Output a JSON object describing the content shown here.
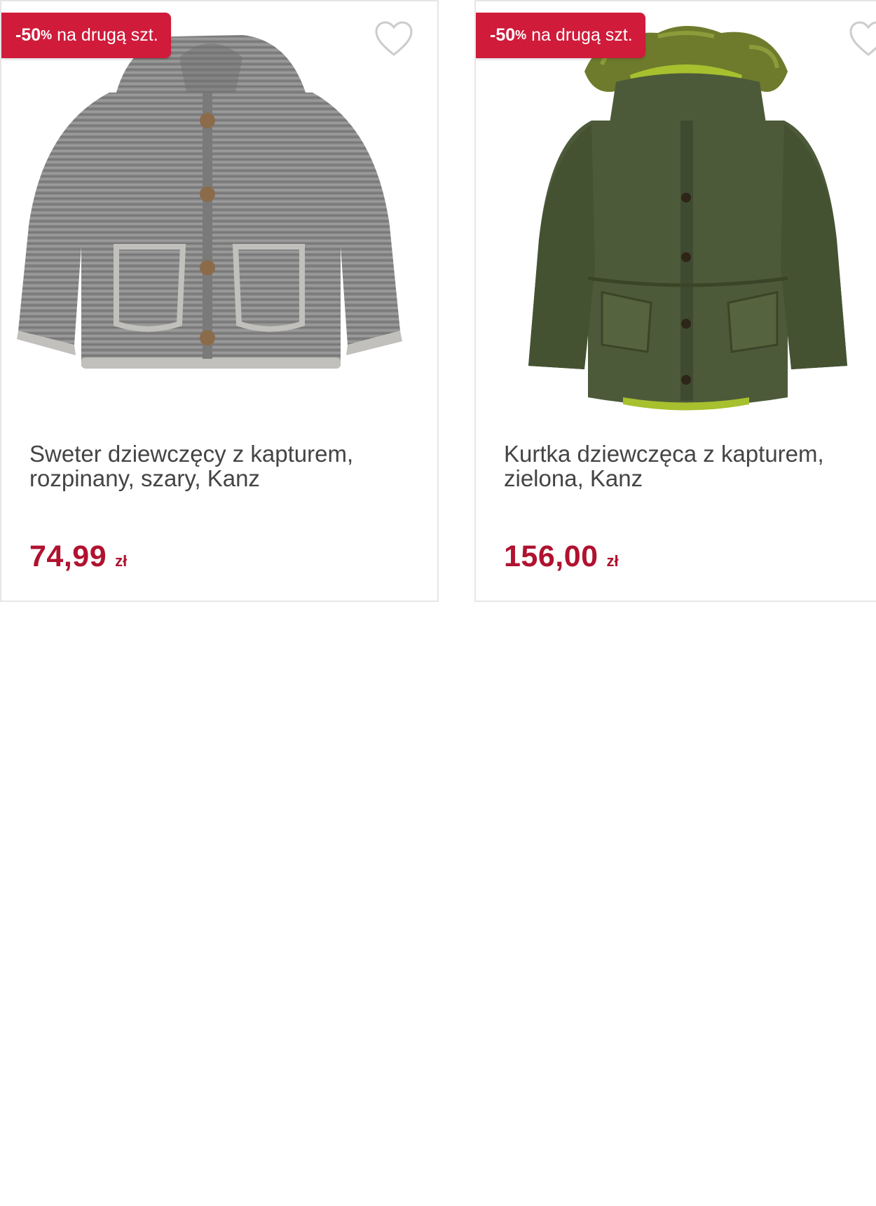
{
  "products": [
    {
      "badge_pct": "-50",
      "badge_pct_sign": "%",
      "badge_rest": "na drugą szt.",
      "title": "Sweter dziewczęcy z kapturem, rozpinany, szary, Kanz",
      "price": "74,99",
      "currency": "zł",
      "image_icon": "grey-knit-hooded-sweater-image",
      "colors": {
        "garment": "#8a8a8a",
        "trim": "#c2c0bc",
        "buttons": "#8b6b4a"
      }
    },
    {
      "badge_pct": "-50",
      "badge_pct_sign": "%",
      "badge_rest": "na drugą szt.",
      "title": "Kurtka dziewczęca z kapturem, zielona, Kanz",
      "price": "156,00",
      "currency": "zł",
      "image_icon": "green-hooded-parka-jacket-image",
      "colors": {
        "garment": "#4c5a3a",
        "fur": "#6e7b2c",
        "lining": "#a7c02e"
      }
    }
  ],
  "colors": {
    "badge_bg": "#d01b3b",
    "price": "#b0122f",
    "title_text": "#444444",
    "card_border": "#e6e6e6"
  },
  "icons": {
    "favorite": "heart-outline-icon"
  }
}
